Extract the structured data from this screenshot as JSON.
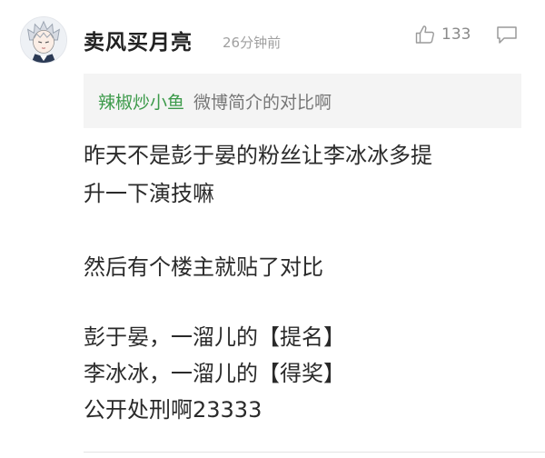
{
  "comment": {
    "username": "卖风买月亮",
    "timestamp": "26分钟前",
    "like_count": "133",
    "quote": {
      "user": "辣椒炒小鱼",
      "text": "微博简介的对比啊"
    },
    "paragraphs": [
      [
        "昨天不是彭于晏的粉丝让李冰冰多提",
        "升一下演技嘛"
      ],
      [
        "然后有个楼主就贴了对比"
      ],
      [
        "彭于晏，一溜儿的【提名】",
        "李冰冰，一溜儿的【得奖】",
        "公开处刑啊23333"
      ]
    ]
  },
  "icons": {
    "avatar": "anime-avatar-icon",
    "like": "thumbs-up-icon",
    "reply": "comment-bubble-icon"
  },
  "colors": {
    "quote_user": "#3c9a4a",
    "quote_background": "#f4f4f4",
    "meta_text": "#a0a0a0",
    "body_text": "#2a2a2a"
  }
}
